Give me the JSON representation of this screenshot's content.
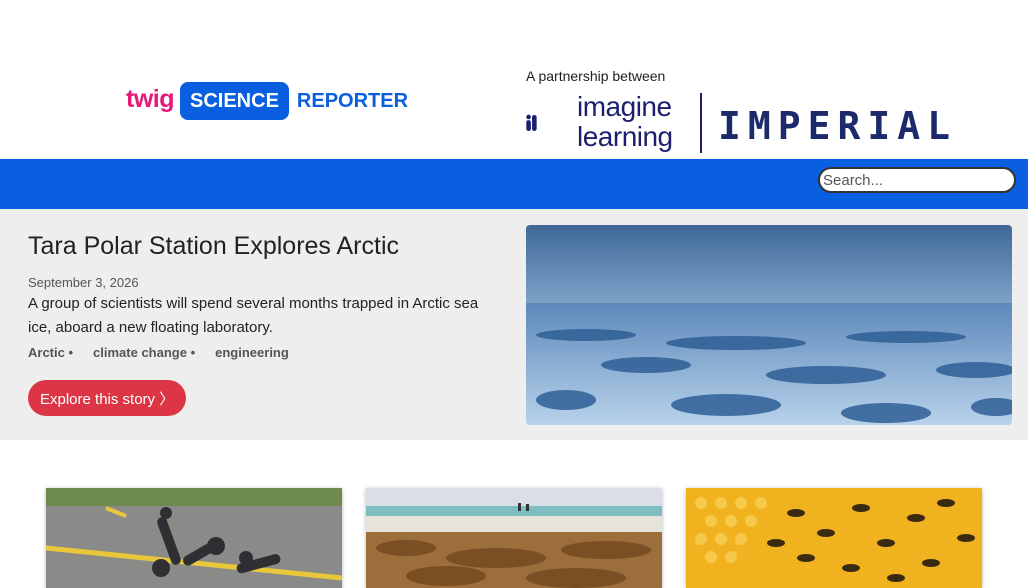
{
  "header": {
    "twig": "twig",
    "science": "SCIENCE",
    "reporter": "REPORTER",
    "partnership": "A partnership between",
    "imagine_line1": "imagine",
    "imagine_line2": "learning",
    "imperial": "IMPERIAL"
  },
  "search": {
    "placeholder": "Search..."
  },
  "colors": {
    "brand_blue": "#0a5ee0",
    "twig_pink": "#e6197a",
    "cta_red": "#dc3545",
    "imperial_navy": "#1c2a6b"
  },
  "featured": {
    "title": "Tara Polar Station Explores Arctic",
    "date": "September 3, 2026",
    "description": "A group of scientists will spend several months trapped in Arctic sea ice, aboard a new floating laboratory.",
    "tags": [
      "Arctic",
      "climate change",
      "engineering"
    ],
    "cta": "Explore this story 〉",
    "image": "arctic-sea-ice-image"
  },
  "cards": [
    {
      "image": "robot-pieces-on-road-image"
    },
    {
      "image": "seaweed-on-beach-image"
    },
    {
      "image": "honeybees-on-honeycomb-image"
    }
  ]
}
